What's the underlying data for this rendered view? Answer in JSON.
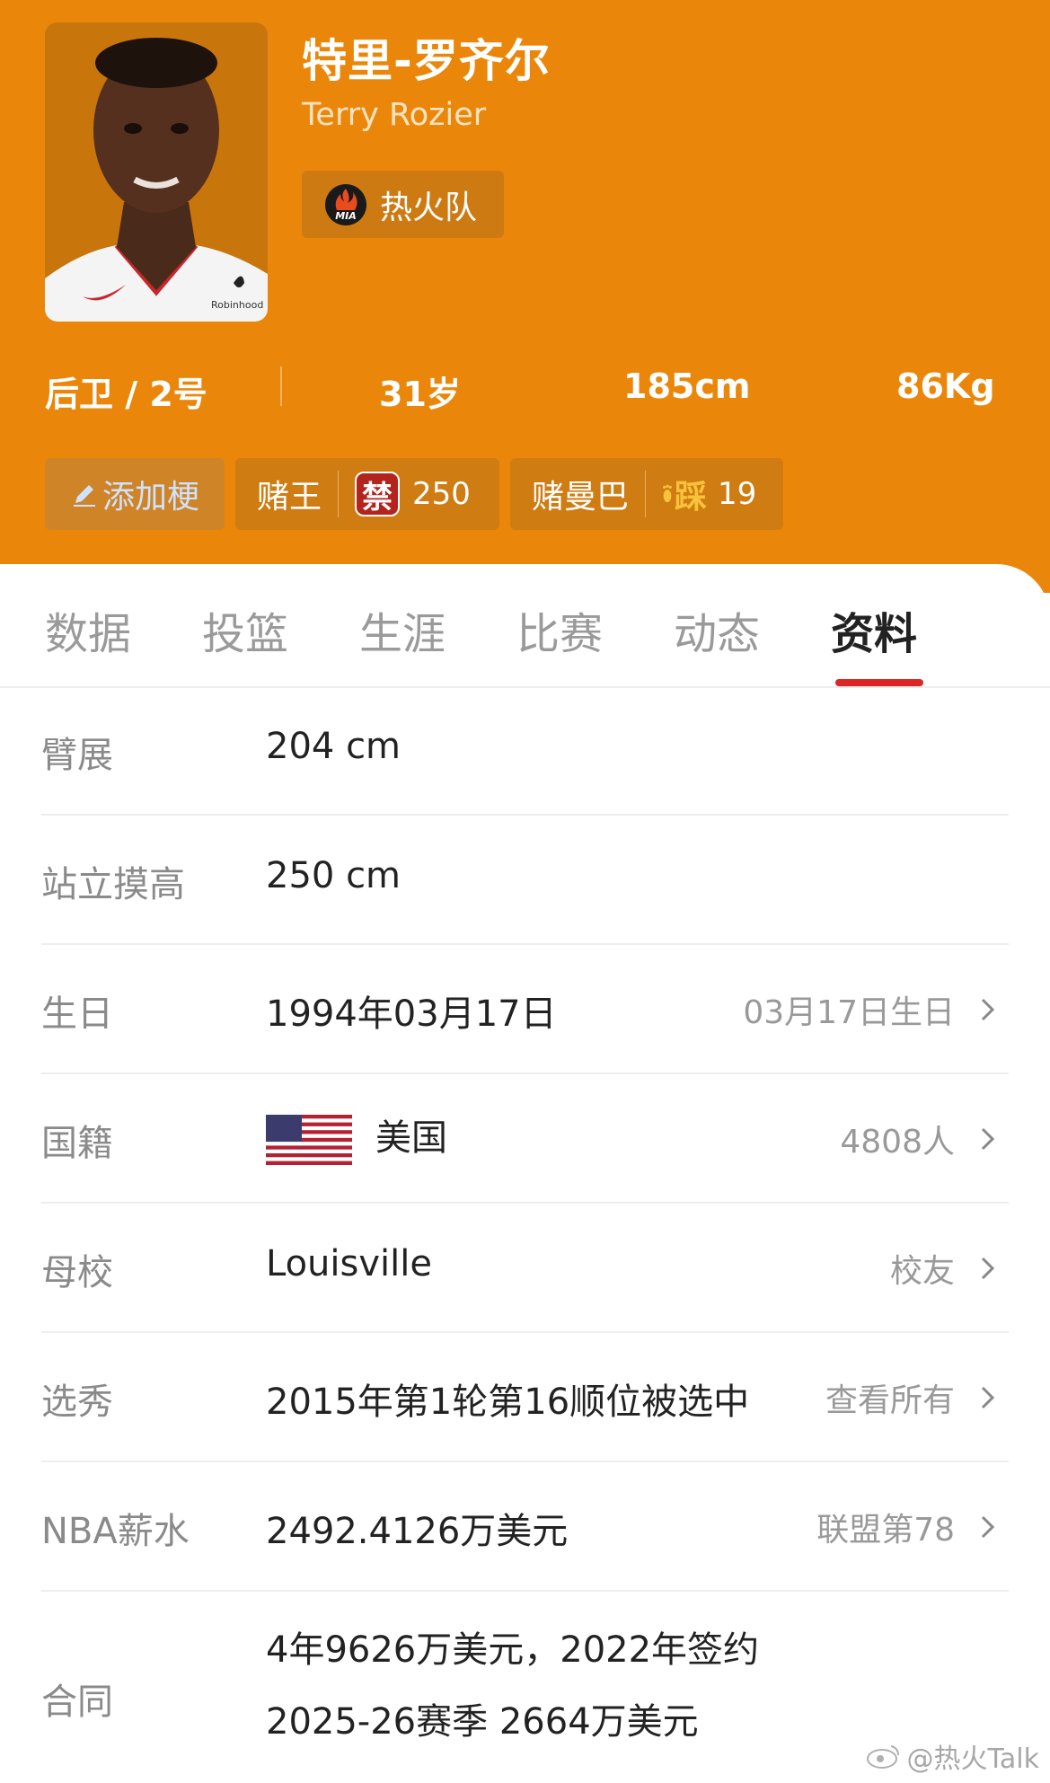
{
  "player": {
    "name_cn": "特里-罗齐尔",
    "name_en": "Terry Rozier",
    "team": "热火队",
    "team_logo_text": "MIA",
    "jersey_sponsor": "Robinhood"
  },
  "stats": {
    "position": "后卫 / 2号",
    "age": "31岁",
    "height": "185cm",
    "weight": "86Kg"
  },
  "tags": {
    "add_label": "添加梗",
    "tag1_label": "赌王",
    "tag1_icon_text": "禁",
    "tag1_count": "250",
    "tag2_label": "赌曼巴",
    "tag2_icon_text": "踩",
    "tag2_count": "19"
  },
  "tabs": [
    "数据",
    "投篮",
    "生涯",
    "比赛",
    "动态",
    "资料"
  ],
  "active_tab": "资料",
  "profile": {
    "wingspan": {
      "label": "臂展",
      "value": "204 cm"
    },
    "reach": {
      "label": "站立摸高",
      "value": "250 cm"
    },
    "birthday": {
      "label": "生日",
      "value": "1994年03月17日",
      "link": "03月17日生日"
    },
    "nationality": {
      "label": "国籍",
      "value": "美国",
      "link": "4808人"
    },
    "school": {
      "label": "母校",
      "value": "Louisville",
      "link": "校友"
    },
    "draft": {
      "label": "选秀",
      "value": "2015年第1轮第16顺位被选中",
      "link": "查看所有"
    },
    "salary": {
      "label": "NBA薪水",
      "value": "2492.4126万美元",
      "link": "联盟第78"
    },
    "contract": {
      "label": "合同",
      "line1": "4年9626万美元，2022年签约",
      "line2": "2025-26赛季 2664万美元"
    }
  },
  "watermark": "@热火Talk",
  "colors": {
    "header": "#EA870B",
    "accent": "#E02323"
  }
}
